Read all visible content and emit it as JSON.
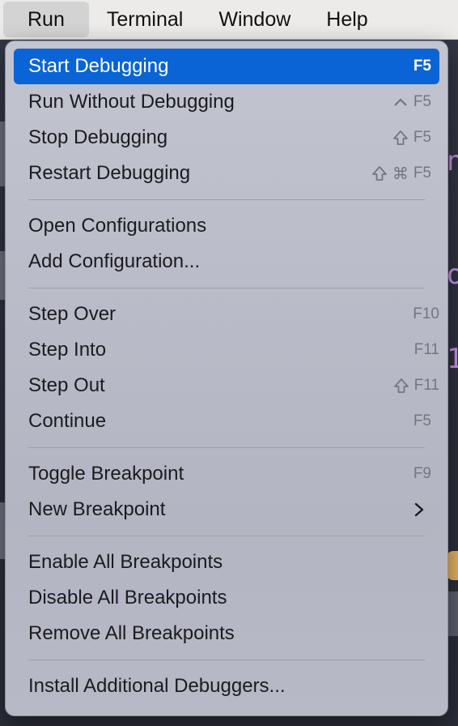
{
  "menubar": {
    "items": [
      "Run",
      "Terminal",
      "Window",
      "Help"
    ],
    "active": "Run"
  },
  "menu": {
    "groups": [
      [
        {
          "label": "Start Debugging",
          "shortcut": "F5",
          "modifiers": [],
          "highlighted": true
        },
        {
          "label": "Run Without Debugging",
          "shortcut": "F5",
          "modifiers": [
            "control"
          ]
        },
        {
          "label": "Stop Debugging",
          "shortcut": "F5",
          "modifiers": [
            "shift"
          ]
        },
        {
          "label": "Restart Debugging",
          "shortcut": "F5",
          "modifiers": [
            "shift",
            "command"
          ]
        }
      ],
      [
        {
          "label": "Open Configurations",
          "shortcut": ""
        },
        {
          "label": "Add Configuration...",
          "shortcut": ""
        }
      ],
      [
        {
          "label": "Step Over",
          "shortcut": "F10"
        },
        {
          "label": "Step Into",
          "shortcut": "F11"
        },
        {
          "label": "Step Out",
          "shortcut": "F11",
          "modifiers": [
            "shift"
          ]
        },
        {
          "label": "Continue",
          "shortcut": "F5"
        }
      ],
      [
        {
          "label": "Toggle Breakpoint",
          "shortcut": "F9"
        },
        {
          "label": "New Breakpoint",
          "submenu": true
        }
      ],
      [
        {
          "label": "Enable All Breakpoints"
        },
        {
          "label": "Disable All Breakpoints"
        },
        {
          "label": "Remove All Breakpoints"
        }
      ],
      [
        {
          "label": "Install Additional Debuggers..."
        }
      ]
    ]
  },
  "icons": {
    "control": "control-modifier-icon",
    "shift": "shift-modifier-icon",
    "command": "command-modifier-icon",
    "submenu": "chevron-right-icon"
  },
  "colors": {
    "highlight": "#0a64d6",
    "menu_bg": "#bcbec9",
    "text": "#1b1b1f",
    "shortcut": "#74767f"
  }
}
